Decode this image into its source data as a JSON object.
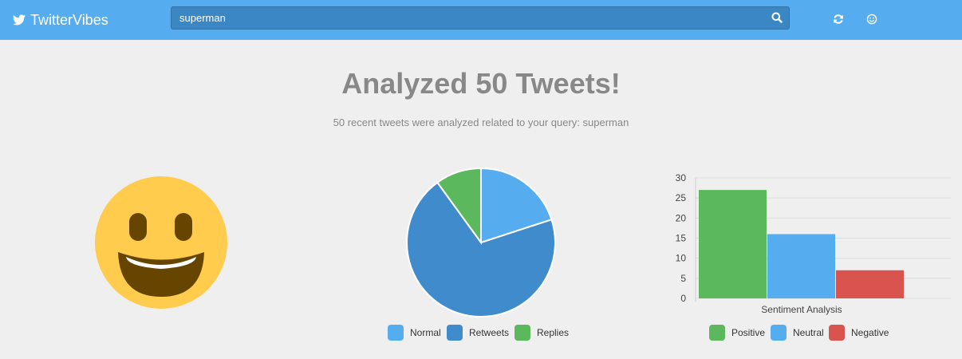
{
  "nav": {
    "brand": "TwitterVibes",
    "search_value": "superman"
  },
  "header": {
    "title": "Analyzed 50 Tweets!",
    "subtitle": "50 recent tweets were analyzed related to your query: superman"
  },
  "mood_icon": "grinning-face-icon",
  "colors": {
    "blue": "#55acee",
    "darkblue": "#3f8bcb",
    "green": "#5cb85c",
    "red": "#d9534f"
  },
  "chart_data": [
    {
      "type": "pie",
      "labels": [
        "Normal",
        "Retweets",
        "Replies"
      ],
      "values": [
        10,
        35,
        5
      ],
      "colors": [
        "#55acee",
        "#3f8bcb",
        "#5cb85c"
      ]
    },
    {
      "type": "bar",
      "categories": [
        "Sentiment Analysis"
      ],
      "series": [
        {
          "name": "Positive",
          "values": [
            27
          ],
          "color": "#5cb85c"
        },
        {
          "name": "Neutral",
          "values": [
            16
          ],
          "color": "#55acee"
        },
        {
          "name": "Negative",
          "values": [
            7
          ],
          "color": "#d9534f"
        }
      ],
      "ylim": [
        0,
        30
      ],
      "yticks": [
        0,
        5,
        10,
        15,
        20,
        25,
        30
      ],
      "grid": true
    }
  ]
}
